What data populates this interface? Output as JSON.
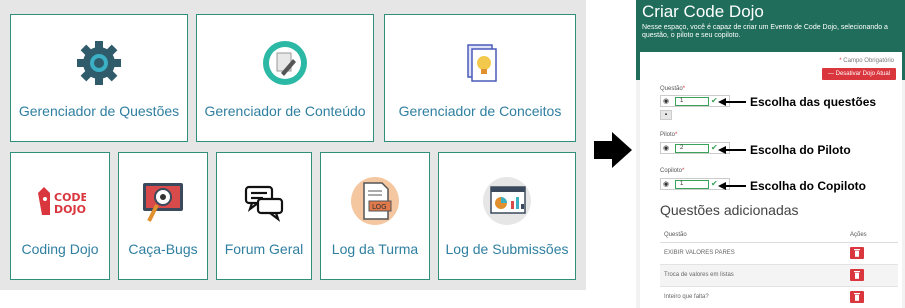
{
  "dashboard": {
    "top_tiles": [
      {
        "label": "Gerenciador de Questões",
        "icon": "gear-icon"
      },
      {
        "label": "Gerenciador de Conteúdo",
        "icon": "content-edit-icon"
      },
      {
        "label": "Gerenciador de Conceitos",
        "icon": "concept-lightbulb-icon"
      }
    ],
    "bottom_tiles": [
      {
        "label": "Coding Dojo",
        "icon": "coding-dojo-logo-icon"
      },
      {
        "label": "Caça-Bugs",
        "icon": "bug-hunt-icon"
      },
      {
        "label": "Forum Geral",
        "icon": "chat-bubbles-icon"
      },
      {
        "label": "Log da Turma",
        "icon": "log-document-icon"
      },
      {
        "label": "Log de Submissões",
        "icon": "analytics-chart-icon"
      }
    ],
    "dojo_logo_text": "CODE DOJO"
  },
  "arrow_icon": "right-arrow-icon",
  "form": {
    "title": "Criar Code Dojo",
    "subtitle": "Nesse espaço, você é capaz de criar um Evento de Code Dojo, selecionando a questão, o piloto e seu copiloto.",
    "required_note": "Campo Obrigatório",
    "required_star": "*",
    "disable_button": "— Desativar Dojo Atual",
    "fields": [
      {
        "label": "Questão",
        "value": "1"
      },
      {
        "label": "Piloto",
        "value": "2"
      },
      {
        "label": "Copiloto",
        "value": "1"
      }
    ],
    "callouts": [
      "Escolha das questões",
      "Escolha do Piloto",
      "Escolha do Copiloto"
    ],
    "added_title": "Questões adicionadas",
    "table": {
      "headers": [
        "Questão",
        "Ações"
      ],
      "rows": [
        "EXIBIR VALORES PARES",
        "Troca de valores em listas",
        "Inteiro que falta?"
      ]
    }
  },
  "colors": {
    "accent": "#1f6d5a",
    "label": "#2f7fa0",
    "danger": "#d9363e",
    "tile_border": "#2f8f7a"
  }
}
